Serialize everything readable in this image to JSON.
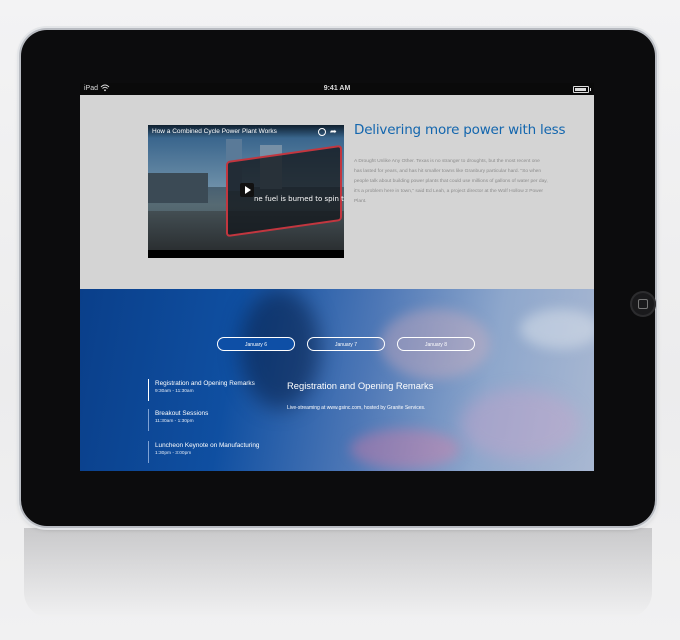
{
  "status_bar": {
    "carrier": "iPad",
    "time": "9:41 AM"
  },
  "video": {
    "title": "How a Combined Cycle Power Plant Works",
    "caption": "ne fuel is burned to spin the"
  },
  "article": {
    "title": "Delivering more power with less",
    "body": "A Drought Unlike Any Other. Texas is no stranger to droughts, but the most recent one has lasted for years, and has hit smaller towns like Granbury particular hard. \"So when people talk about building power plants that could use millions of gallons of water per day, it's a problem here in town,\" said Ed Leah, a project director at the Wolf Hollow 2 Power Plant."
  },
  "events": {
    "tabs": [
      {
        "label": "January 6",
        "active": true
      },
      {
        "label": "January 7",
        "active": false
      },
      {
        "label": "January 8",
        "active": false
      }
    ],
    "sessions": [
      {
        "title": "Registration and Opening Remarks",
        "time": "9:30am - 11:30am"
      },
      {
        "title": "Breakout Sessions",
        "time": "11:30am - 1:30pm"
      },
      {
        "title": "Luncheon Keynote on Manufacturing",
        "time": "1:30pm - 3:00pm"
      }
    ],
    "detail": {
      "title": "Registration and Opening Remarks",
      "description": "Live-streaming at www.gsinc.com, hosted by Granite Services."
    }
  },
  "colors": {
    "accent_blue": "#1366ae",
    "active_tab": "#0e4fa6",
    "device_bezel": "#0c0c0d",
    "screen_bg": "#d4d4d4"
  },
  "icons": [
    "wifi-icon",
    "battery-icon",
    "play-icon",
    "clock-icon",
    "share-icon",
    "home-button"
  ]
}
